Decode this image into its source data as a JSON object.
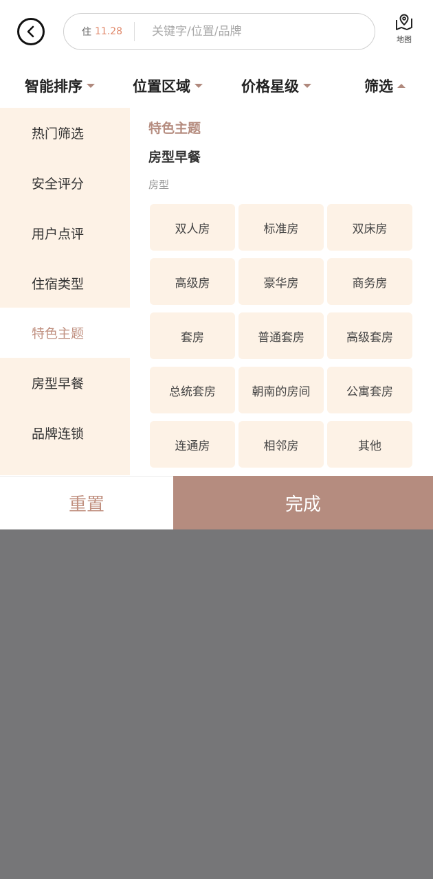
{
  "header": {
    "date_label": "住",
    "date_value": "11.28",
    "search_placeholder": "关键字/位置/品牌",
    "map_label": "地图"
  },
  "sort_tabs": [
    {
      "label": "智能排序"
    },
    {
      "label": "位置区域"
    },
    {
      "label": "价格星级"
    },
    {
      "label": "筛选"
    }
  ],
  "categories": [
    {
      "label": "热门筛选"
    },
    {
      "label": "安全评分"
    },
    {
      "label": "用户点评"
    },
    {
      "label": "住宿类型"
    },
    {
      "label": "特色主题",
      "active": true
    },
    {
      "label": "房型早餐"
    },
    {
      "label": "品牌连锁"
    }
  ],
  "content": {
    "section_title": "特色主题",
    "section_title_2": "房型早餐",
    "sub_label": "房型",
    "tags": [
      "双人房",
      "标准房",
      "双床房",
      "高级房",
      "豪华房",
      "商务房",
      "套房",
      "普通套房",
      "高级套房",
      "总统套房",
      "朝南的房间",
      "公寓套房",
      "连通房",
      "相邻房",
      "其他"
    ]
  },
  "footer": {
    "reset_label": "重置",
    "done_label": "完成"
  },
  "colors": {
    "accent": "#b58c7f",
    "tag_bg": "#fdf2e6",
    "overlay": "#767678"
  }
}
